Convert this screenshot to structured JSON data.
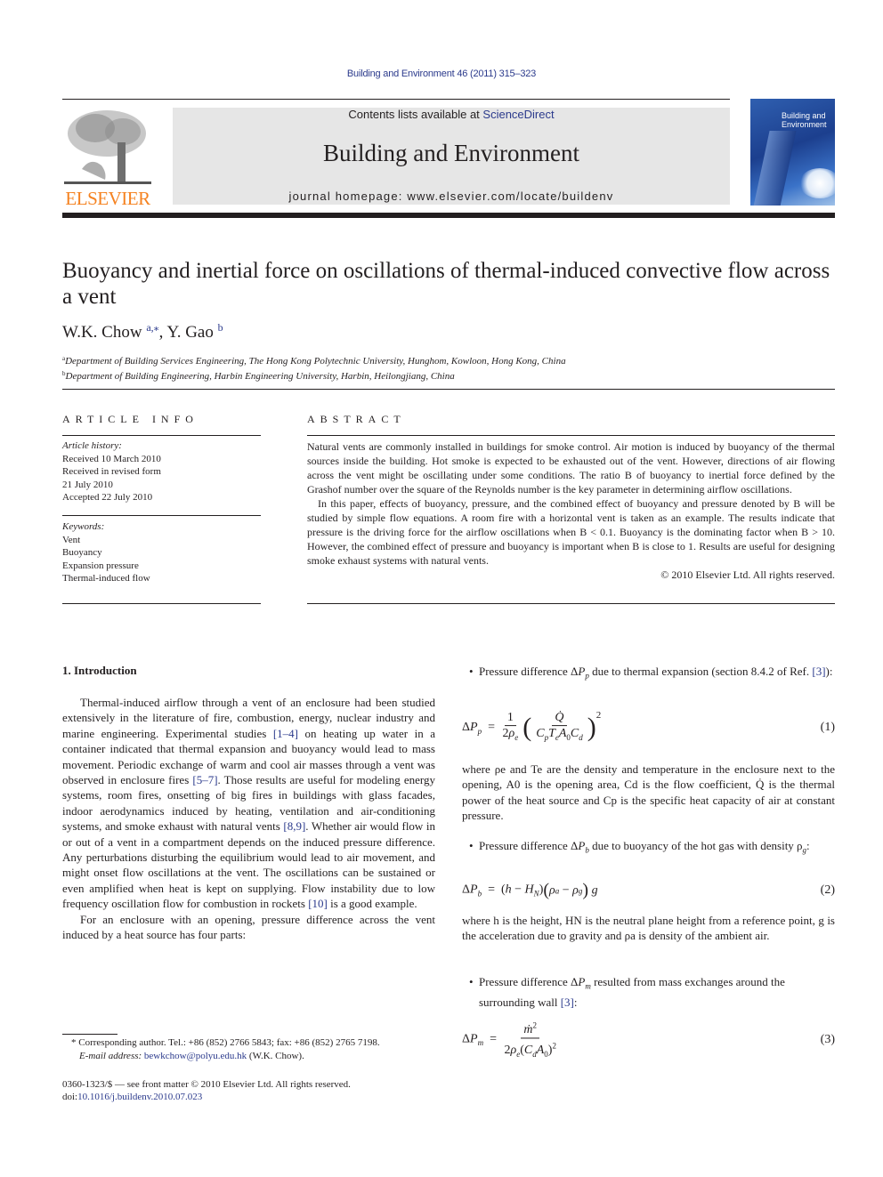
{
  "header": {
    "journal_ref": "Building and Environment 46 (2011) 315–323",
    "contents_prefix": "Contents lists available at ",
    "contents_link": "ScienceDirect",
    "journal_name": "Building and Environment",
    "homepage": "journal homepage: www.elsevier.com/locate/buildenv",
    "publisher_logo_text": "ELSEVIER",
    "cover_title_line1": "Building and",
    "cover_title_line2": "Environment",
    "colors": {
      "publisher_orange": "#f58220",
      "link_blue": "#2b3a8c",
      "masthead_gray": "#e6e6e6",
      "cover_blue": "#1c3f8e"
    }
  },
  "article": {
    "title": "Buoyancy and inertial force on oscillations of thermal-induced convective flow across a vent",
    "authors": [
      {
        "name": "W.K. Chow",
        "marks": "a,⁎"
      },
      {
        "name": "Y. Gao",
        "marks": "b"
      }
    ],
    "author_separator": ", ",
    "affiliations": [
      {
        "mark": "a",
        "text": "Department of Building Services Engineering, The Hong Kong Polytechnic University, Hunghom, Kowloon, Hong Kong, China"
      },
      {
        "mark": "b",
        "text": "Department of Building Engineering, Harbin Engineering University, Harbin, Heilongjiang, China"
      }
    ]
  },
  "article_info": {
    "heading": "ARTICLE INFO",
    "history_label": "Article history:",
    "history": [
      "Received 10 March 2010",
      "Received in revised form",
      "21 July 2010",
      "Accepted 22 July 2010"
    ],
    "keywords_label": "Keywords:",
    "keywords": [
      "Vent",
      "Buoyancy",
      "Expansion pressure",
      "Thermal-induced flow"
    ]
  },
  "abstract": {
    "heading": "ABSTRACT",
    "paragraphs": [
      "Natural vents are commonly installed in buildings for smoke control. Air motion is induced by buoyancy of the thermal sources inside the building. Hot smoke is expected to be exhausted out of the vent. However, directions of air flowing across the vent might be oscillating under some conditions. The ratio B of buoyancy to inertial force defined by the Grashof number over the square of the Reynolds number is the key parameter in determining airflow oscillations.",
      "In this paper, effects of buoyancy, pressure, and the combined effect of buoyancy and pressure denoted by B will be studied by simple flow equations. A room fire with a horizontal vent is taken as an example. The results indicate that pressure is the driving force for the airflow oscillations when B < 0.1. Buoyancy is the dominating factor when B > 10. However, the combined effect of pressure and buoyancy is important when B is close to 1. Results are useful for designing smoke exhaust systems with natural vents."
    ],
    "copyright": "© 2010 Elsevier Ltd. All rights reserved."
  },
  "introduction": {
    "heading": "1.  Introduction",
    "p1_parts": [
      "Thermal-induced airflow through a vent of an enclosure had been studied extensively in the literature of fire, combustion, energy, nuclear industry and marine engineering. Experimental studies ",
      "[1–4]",
      " on heating up water in a container indicated that thermal expansion and buoyancy would lead to mass movement. Periodic exchange of warm and cool air masses through a vent was observed in enclosure fires ",
      "[5–7]",
      ". Those results are useful for modeling energy systems, room fires, onsetting of big fires in buildings with glass facades, indoor aerodynamics induced by heating, ventilation and air-conditioning systems, and smoke exhaust with natural vents ",
      "[8,9]",
      ". Whether air would flow in or out of a vent in a compartment depends on the induced pressure difference. Any perturbations disturbing the equilibrium would lead to air movement, and might onset flow oscillations at the vent. The oscillations can be sustained or even amplified when heat is kept on supplying. Flow instability due to low frequency oscillation flow for combustion in rockets ",
      "[10]",
      " is a good example."
    ],
    "p2": "For an enclosure with an opening, pressure difference across the vent induced by a heat source has four parts:"
  },
  "footnote": {
    "star": "*",
    "corresponding": "Corresponding author. Tel.: +86 (852) 2766 5843; fax: +86 (852) 2765 7198.",
    "email_label": "E-mail address:",
    "email": "bewkchow@polyu.edu.hk",
    "email_suffix": " (W.K. Chow).",
    "front_matter": "0360-1323/$ — see front matter © 2010 Elsevier Ltd. All rights reserved.",
    "doi_label": "doi:",
    "doi": "10.1016/j.buildenv.2010.07.023"
  },
  "right_column": {
    "bullet_char": "•",
    "bullet1_pre": "Pressure difference Δ",
    "bullet1_sym": "P",
    "bullet1_sub": "p",
    "bullet1_post": " due to thermal expansion (section 8.4.2 of Ref. ",
    "bullet1_ref": "[3]",
    "bullet1_end": "):",
    "eq1_number": "(1)",
    "para_eq1": "where ρe and Te are the density and temperature in the enclosure next to the opening, A0 is the opening area, Cd is the flow coefficient, Q̇ is the thermal power of the heat source and Cp is the specific heat capacity of air at constant pressure.",
    "bullet2_pre": "Pressure difference Δ",
    "bullet2_sym": "P",
    "bullet2_sub": "b",
    "bullet2_post": " due to buoyancy of the hot gas with density ρ",
    "bullet2_sub2": "g",
    "bullet2_end": ":",
    "eq2_number": "(2)",
    "para_eq2": "where h is the height, HN is the neutral plane height from a reference point, g is the acceleration due to gravity and ρa is density of the ambient air.",
    "bullet3_pre": "Pressure difference Δ",
    "bullet3_sym": "P",
    "bullet3_sub": "m",
    "bullet3_post": " resulted from mass exchanges around the surrounding wall ",
    "bullet3_ref": "[3]",
    "bullet3_end": ":",
    "eq3_number": "(3)"
  }
}
